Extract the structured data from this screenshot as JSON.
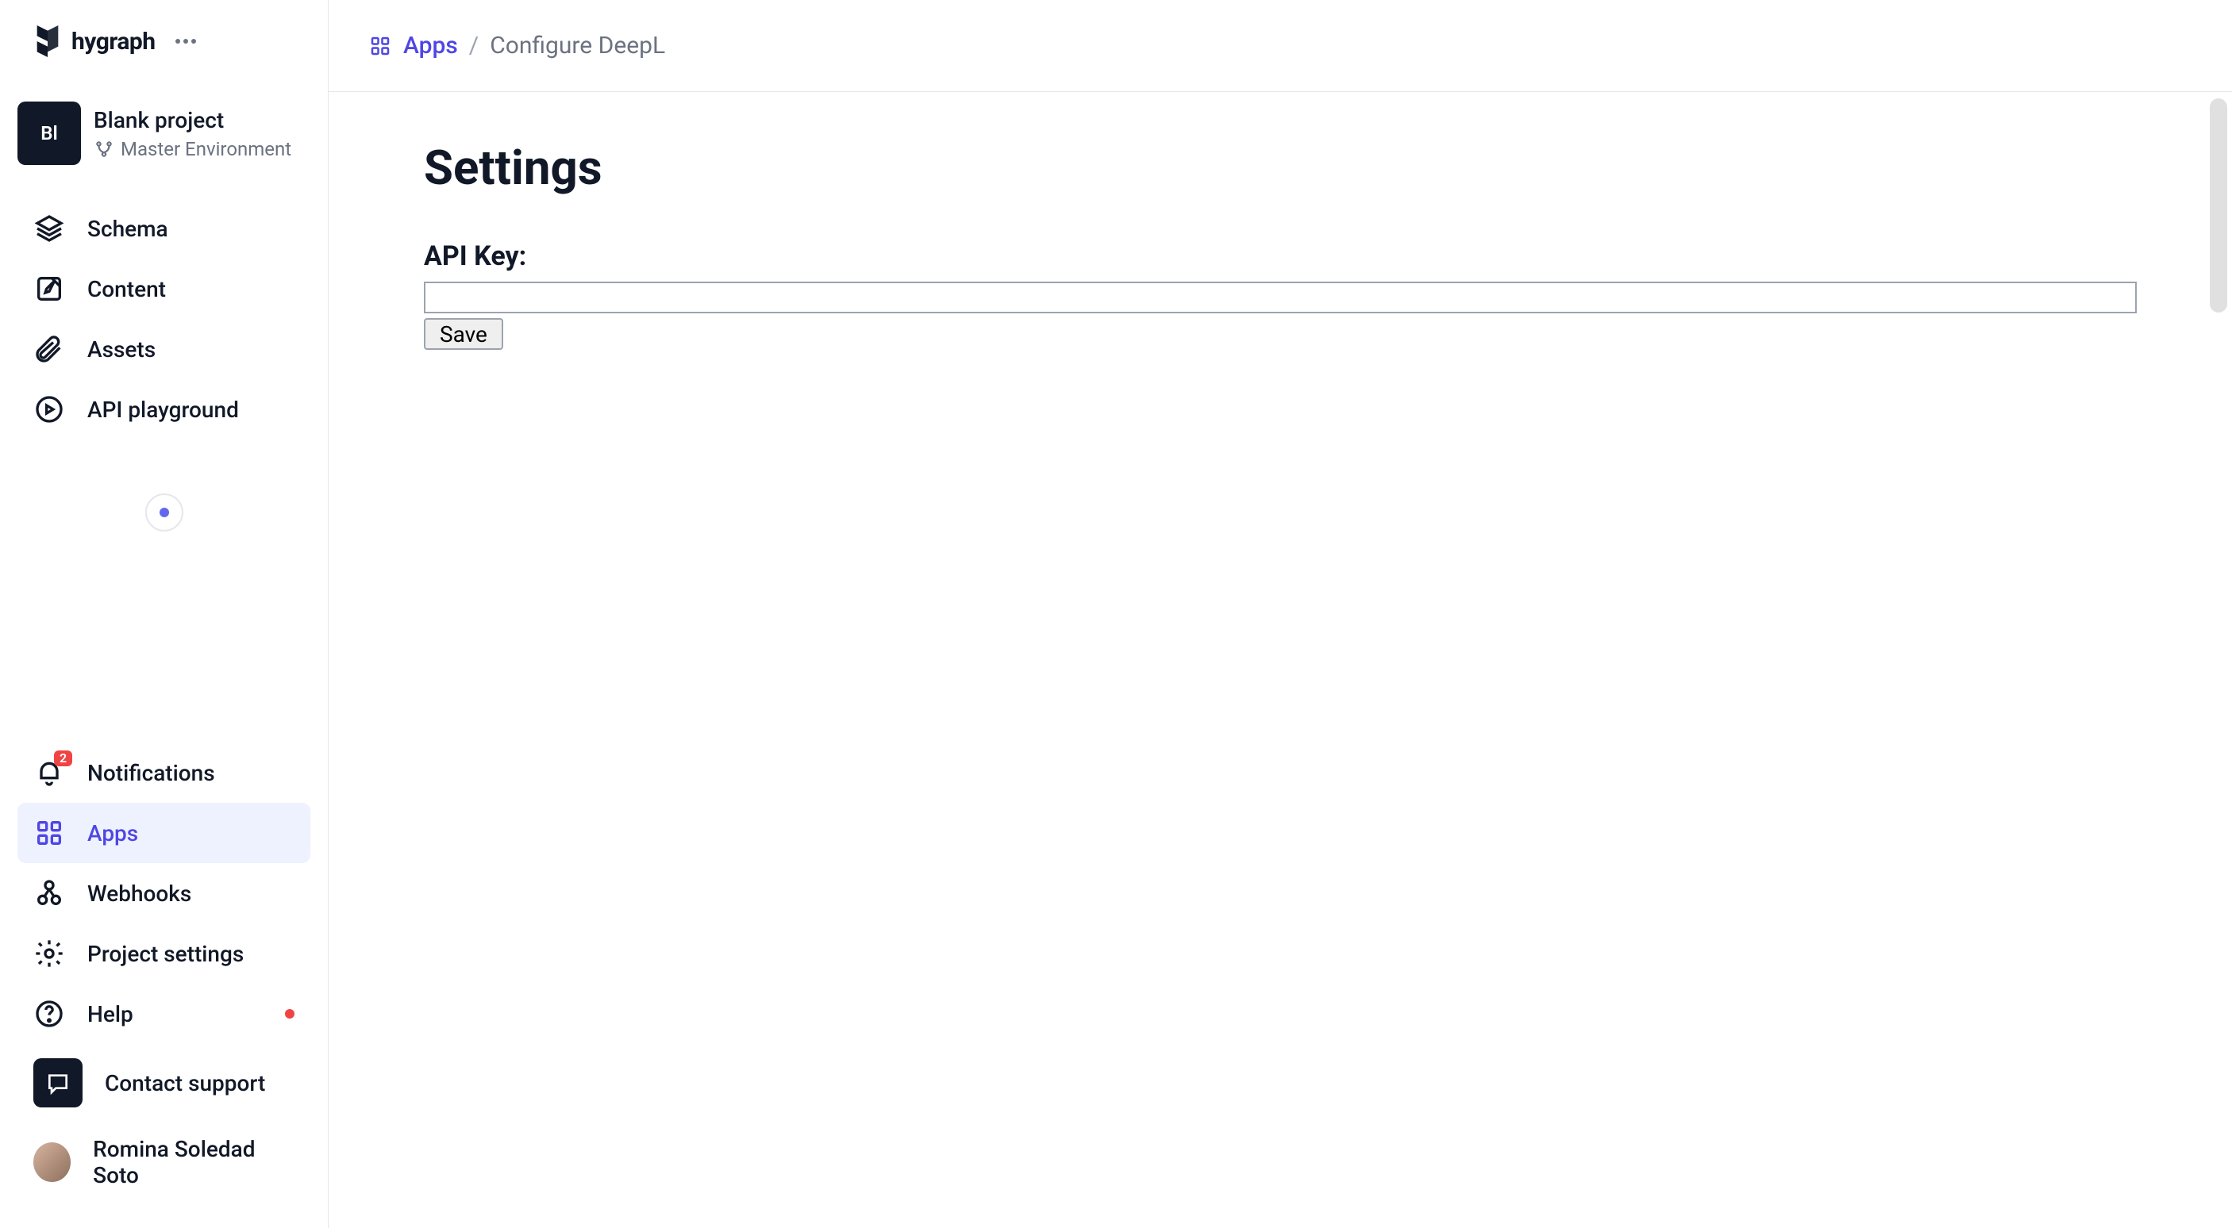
{
  "brand": {
    "name": "hygraph"
  },
  "project": {
    "avatar_initials": "Bl",
    "name": "Blank project",
    "environment": "Master Environment"
  },
  "nav_top": {
    "schema": "Schema",
    "content": "Content",
    "assets": "Assets",
    "api_playground": "API playground"
  },
  "nav_bottom": {
    "notifications": "Notifications",
    "notifications_badge": "2",
    "apps": "Apps",
    "webhooks": "Webhooks",
    "project_settings": "Project settings",
    "help": "Help",
    "contact_support": "Contact support"
  },
  "user": {
    "name": "Romina Soledad Soto"
  },
  "breadcrumb": {
    "root": "Apps",
    "sep": "/",
    "current": "Configure DeepL"
  },
  "page": {
    "title": "Settings",
    "api_key_label": "API Key:",
    "api_key_value": "",
    "save_label": "Save"
  }
}
